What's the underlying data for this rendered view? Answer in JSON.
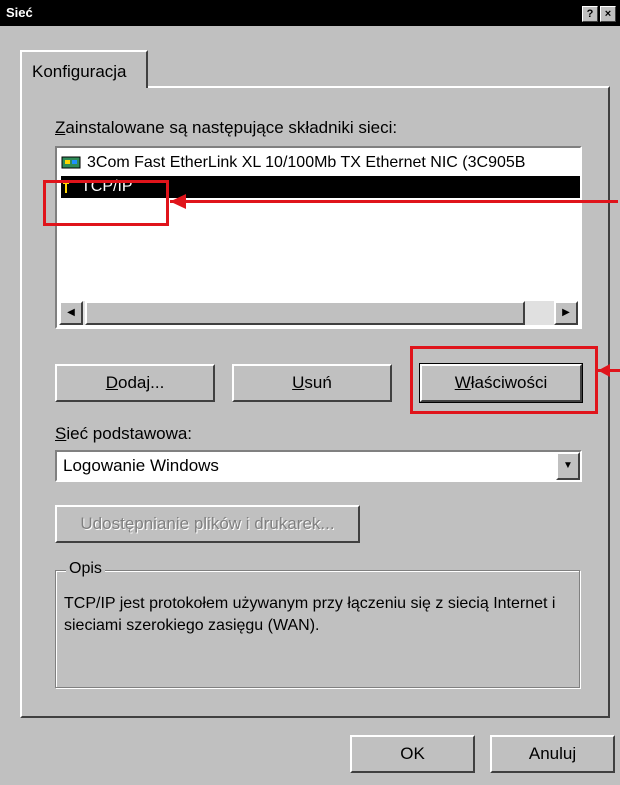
{
  "window": {
    "title": "Sieć",
    "help_glyph": "?",
    "close_glyph": "×"
  },
  "tab": {
    "label": "Konfiguracja"
  },
  "components": {
    "label_first": "Z",
    "label_rest": "ainstalowane są następujące składniki sieci:",
    "items": [
      {
        "icon": "network-card-icon",
        "label": "3Com Fast EtherLink XL 10/100Mb TX Ethernet NIC (3C905B"
      },
      {
        "icon": "protocol-icon",
        "label": "TCP/IP",
        "selected": true
      }
    ],
    "scroll_left": "◀",
    "scroll_right": "▶"
  },
  "buttons": {
    "add_first": "D",
    "add_rest": "odaj...",
    "remove_first": "U",
    "remove_rest": "suń",
    "properties_first": "W",
    "properties_rest": "łaściwości"
  },
  "primary_network": {
    "label_first": "S",
    "label_rest": "ieć podstawowa:",
    "value": "Logowanie Windows",
    "dropdown_glyph": "▼"
  },
  "sharing_button": "Udostępnianie plików i drukarek...",
  "description": {
    "legend": "Opis",
    "text": "TCP/IP jest protokołem używanym przy łączeniu się z siecią Internet i sieciami szerokiego zasięgu (WAN)."
  },
  "footer": {
    "ok": "OK",
    "cancel": "Anuluj"
  },
  "colors": {
    "highlight": "#e0141b",
    "selection": "#000000",
    "face": "#c0c0c0"
  }
}
